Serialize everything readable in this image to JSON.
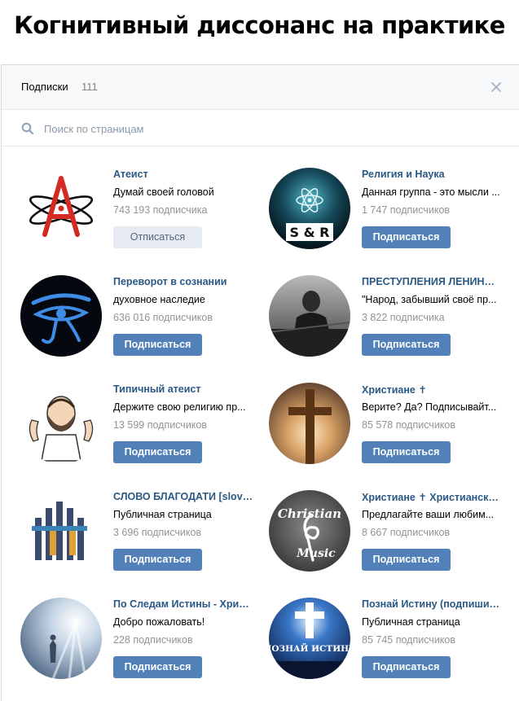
{
  "meme_title": "Когнитивный диссонанс на практике",
  "header": {
    "title": "Подписки",
    "count": "111"
  },
  "search": {
    "placeholder": "Поиск по страницам"
  },
  "colors": {
    "link": "#2a5885",
    "button_primary": "#5181b8",
    "button_secondary": "#e5ebf1",
    "muted": "#939393"
  },
  "communities": [
    {
      "name": "Атеист",
      "desc": "Думай своей головой",
      "subs": "743 193 подписчика",
      "button": "Отписаться",
      "subscribed": true,
      "avatar_icon": "atheism-atom-icon"
    },
    {
      "name": "Религия и Наука",
      "desc": "Данная группа - это мысли ...",
      "subs": "1 747 подписчиков",
      "button": "Подписаться",
      "subscribed": false,
      "avatar_icon": "science-religion-atom-icon",
      "avatar_text": "S & R"
    },
    {
      "name": "Переворот в сознании",
      "desc": "духовное наследие",
      "subs": "636 016 подписчиков",
      "button": "Подписаться",
      "subscribed": false,
      "avatar_icon": "eye-of-horus-icon"
    },
    {
      "name": "ПРЕСТУПЛЕНИЯ ЛЕНИНА ...",
      "desc": "\"Народ, забывший своё пр...",
      "subs": "3 822 подписчика",
      "button": "Подписаться",
      "subscribed": false,
      "avatar_icon": "historical-photo-icon"
    },
    {
      "name": "Типичный атеист",
      "desc": "Держите свою религию пр...",
      "subs": "13 599 подписчиков",
      "button": "Подписаться",
      "subscribed": false,
      "avatar_icon": "cartoon-man-icon"
    },
    {
      "name": "Христиане ✝",
      "desc": "Верите? Да? Подписывайт...",
      "subs": "85 578 подписчиков",
      "button": "Подписаться",
      "subscribed": false,
      "avatar_icon": "wooden-cross-icon"
    },
    {
      "name": "СЛОВО БЛАГОДАТИ [slovo...",
      "desc": "Публичная страница",
      "subs": "3 696 подписчиков",
      "button": "Подписаться",
      "subscribed": false,
      "avatar_icon": "church-logo-icon"
    },
    {
      "name": "Христиане ✝ Христианская...",
      "desc": "Предлагайте ваши любим...",
      "subs": "8 667 подписчиков",
      "button": "Подписаться",
      "subscribed": false,
      "avatar_icon": "christian-music-icon",
      "avatar_text_1": "Christian",
      "avatar_text_2": "Music"
    },
    {
      "name": "По Следам Истины - Христ...",
      "desc": "Добро пожаловать!",
      "subs": "228 подписчиков",
      "button": "Подписаться",
      "subscribed": false,
      "avatar_icon": "heavenly-light-icon"
    },
    {
      "name": "Познай Истину (подпишись)",
      "desc": "Публичная страница",
      "subs": "85 745 подписчиков",
      "button": "Подписаться",
      "subscribed": false,
      "avatar_icon": "glowing-cross-icon",
      "avatar_text": "ПОЗНАЙ ИСТИНУ"
    }
  ]
}
